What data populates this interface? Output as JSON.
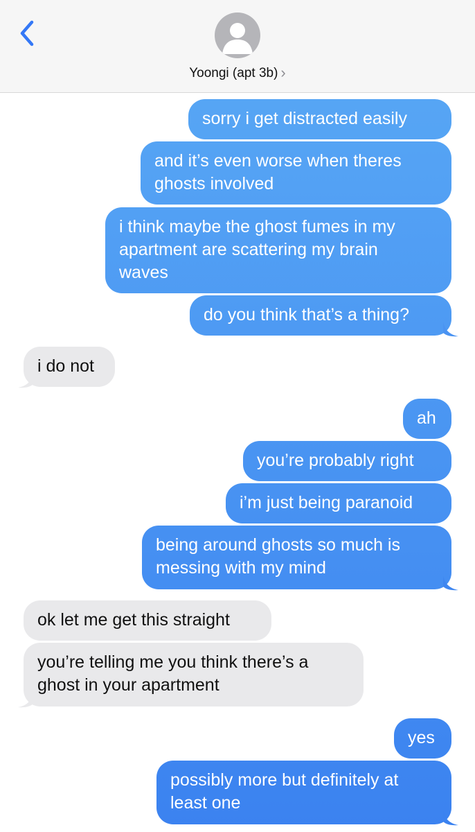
{
  "header": {
    "contact_name": "Yoongi (apt 3b)",
    "chevron": "›",
    "back_icon": "chevron-left-icon",
    "avatar_icon": "person-icon"
  },
  "colors": {
    "sent_top": "#5aaaf5",
    "sent_bottom": "#3b82f0",
    "received": "#e9e9eb",
    "ios_blue": "#3478f6"
  },
  "messages": [
    {
      "from": "me",
      "lines": [
        "sorry i get distracted easily"
      ]
    },
    {
      "from": "me",
      "lines": [
        "and it’s even worse when theres",
        "ghosts involved"
      ]
    },
    {
      "from": "me",
      "lines": [
        "i think maybe the ghost fumes in my",
        "apartment are scattering my brain",
        "waves"
      ]
    },
    {
      "from": "me",
      "lines": [
        "do you think that’s a thing?"
      ]
    },
    {
      "from": "them",
      "lines": [
        "i do not"
      ]
    },
    {
      "from": "me",
      "lines": [
        "ah"
      ]
    },
    {
      "from": "me",
      "lines": [
        "you’re probably right"
      ]
    },
    {
      "from": "me",
      "lines": [
        "i’m just being paranoid"
      ]
    },
    {
      "from": "me",
      "lines": [
        "being around ghosts so much is",
        "messing with my mind"
      ]
    },
    {
      "from": "them",
      "lines": [
        "ok let me get this straight"
      ]
    },
    {
      "from": "them",
      "lines": [
        "you’re telling me you think there’s a",
        "ghost in your apartment"
      ]
    },
    {
      "from": "me",
      "lines": [
        "yes"
      ]
    },
    {
      "from": "me",
      "lines": [
        "possibly more but definitely at",
        "least one"
      ]
    }
  ]
}
